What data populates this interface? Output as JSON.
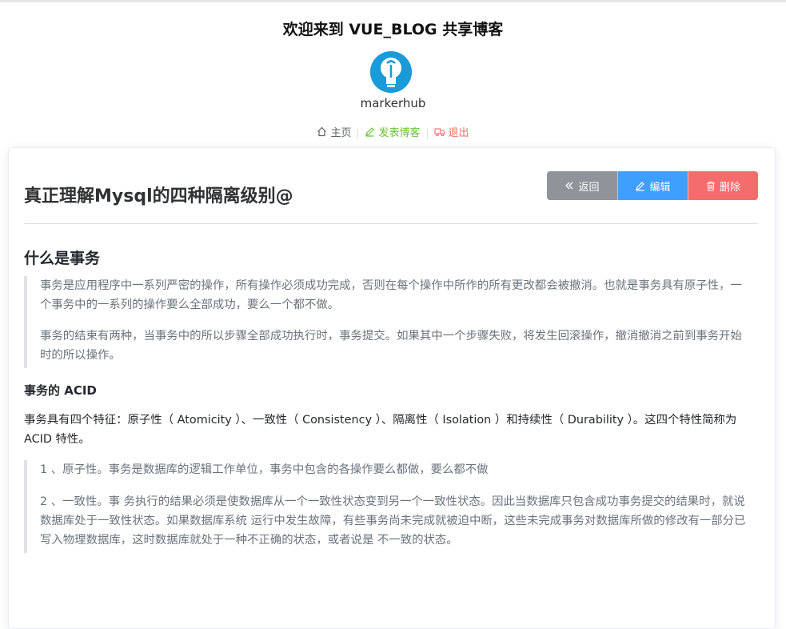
{
  "site": {
    "title": "欢迎来到 VUE_BLOG 共享博客",
    "username": "markerhub"
  },
  "nav": {
    "home": "主页",
    "post": "发表博客",
    "logout": "退出"
  },
  "blog": {
    "title": "真正理解Mysql的四种隔离级别@",
    "buttons": {
      "back": "返回",
      "edit": "编辑",
      "delete": "删除"
    },
    "content": {
      "heading": "什么是事务",
      "quote1": [
        "事务是应用程序中一系列严密的操作，所有操作必须成功完成，否则在每个操作中所作的所有更改都会被撤消。也就是事务具有原子性，一个事务中的一系列的操作要么全部成功，要么一个都不做。",
        "事务的结束有两种，当事务中的所以步骤全部成功执行时，事务提交。如果其中一个步骤失败，将发生回滚操作，撤消撤消之前到事务开始时的所以操作。"
      ],
      "subheading": "事务的 ACID",
      "paragraph": "事务具有四个特征：原子性（ Atomicity ）、一致性（ Consistency ）、隔离性（ Isolation ）和持续性（ Durability ）。这四个特性简称为 ACID 特性。",
      "quote2": [
        "1 、原子性。事务是数据库的逻辑工作单位，事务中包含的各操作要么都做，要么都不做",
        "2 、一致性。事 务执行的结果必须是使数据库从一个一致性状态变到另一个一致性状态。因此当数据库只包含成功事务提交的结果时，就说数据库处于一致性状态。如果数据库系统 运行中发生故障，有些事务尚未完成就被迫中断，这些未完成事务对数据库所做的修改有一部分已写入物理数据库，这时数据库就处于一种不正确的状态，或者说是 不一致的状态。"
      ]
    }
  },
  "icons": {
    "avatar": "lightbulb-icon",
    "home": "home-icon",
    "post": "pencil-icon",
    "logout": "truck-icon",
    "back": "double-chevron-left-icon",
    "edit": "pencil-icon",
    "delete": "trash-icon"
  },
  "colors": {
    "primary": "#409eff",
    "success": "#67c23a",
    "danger": "#f56c6c",
    "info": "#909399"
  }
}
